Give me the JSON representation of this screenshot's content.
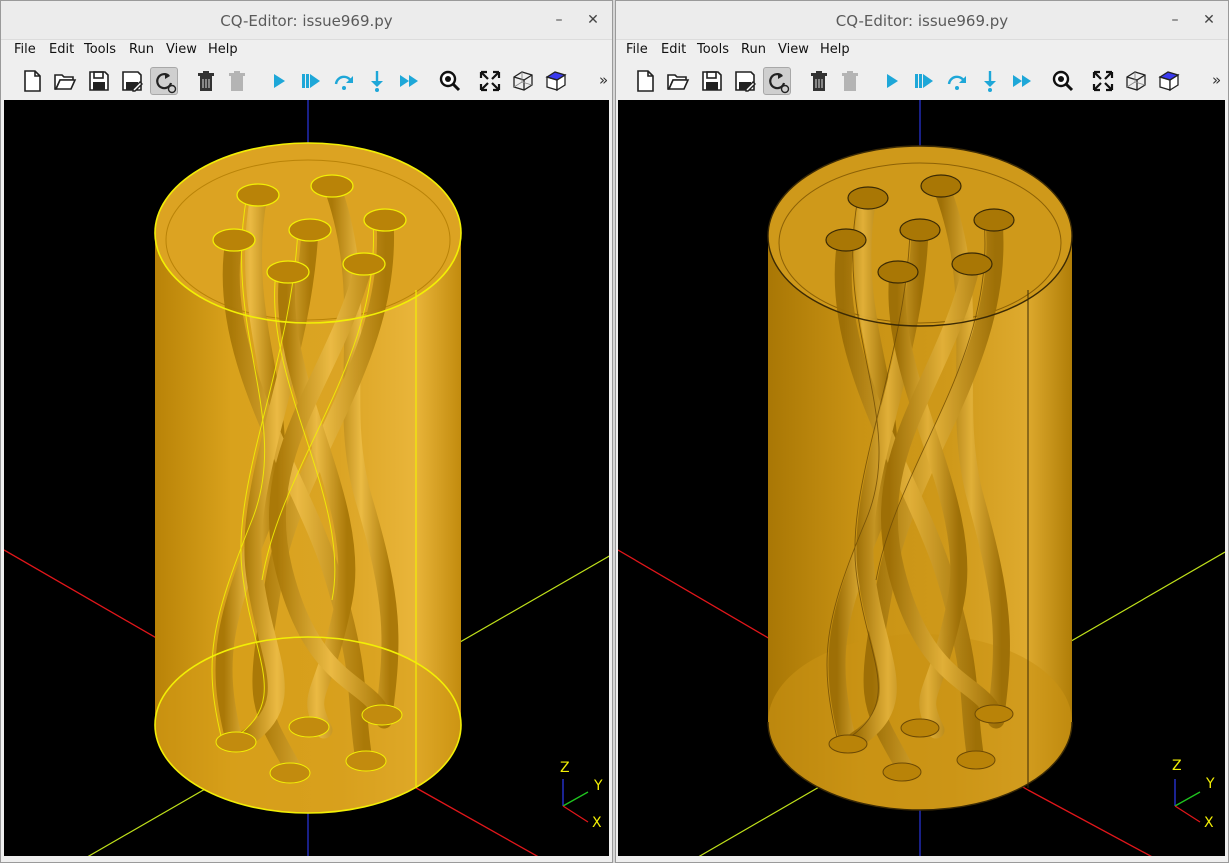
{
  "colors": {
    "model_fill": "#d59c17",
    "model_light": "#e6b43a",
    "model_dark": "#a67506",
    "edge_highlight": "#f2ef05",
    "edge_dark": "#3b2a05",
    "axis_x": "#e0161a",
    "axis_y": "#bfe01a",
    "axis_z": "#2a36e0",
    "viewport_bg": "#000000"
  },
  "windows": [
    {
      "title": "CQ-Editor: issue969.py",
      "menu": [
        "File",
        "Edit",
        "Tools",
        "Run",
        "View",
        "Help"
      ],
      "toolbar": [
        "new-file-icon",
        "open-file-icon",
        "save-icon",
        "save-as-icon",
        "autoreload-icon",
        "delete-icon",
        "delete-disabled-icon",
        "render-icon",
        "debug-icon",
        "step-over-icon",
        "step-in-icon",
        "continue-icon",
        "zoom-icon",
        "fit-icon",
        "wireframe-icon",
        "shaded-icon"
      ],
      "view_state": "edges-highlighted",
      "axes_labels": {
        "z": "Z",
        "y": "Y",
        "x": "X"
      }
    },
    {
      "title": "CQ-Editor: issue969.py",
      "menu": [
        "File",
        "Edit",
        "Tools",
        "Run",
        "View",
        "Help"
      ],
      "toolbar": [
        "new-file-icon",
        "open-file-icon",
        "save-icon",
        "save-as-icon",
        "autoreload-icon",
        "delete-icon",
        "delete-disabled-icon",
        "render-icon",
        "debug-icon",
        "step-over-icon",
        "step-in-icon",
        "continue-icon",
        "zoom-icon",
        "fit-icon",
        "wireframe-icon",
        "shaded-icon"
      ],
      "view_state": "shaded",
      "axes_labels": {
        "z": "Z",
        "y": "Y",
        "x": "X"
      }
    }
  ]
}
